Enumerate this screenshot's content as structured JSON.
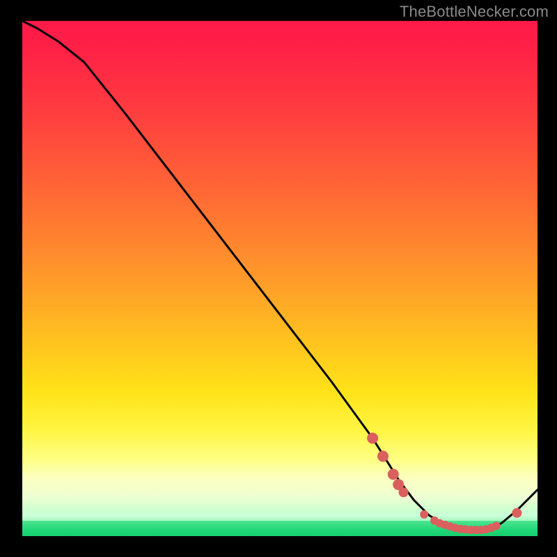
{
  "watermark": "TheBottleNecker.com",
  "colors": {
    "background": "#000000",
    "curve_stroke": "#000000",
    "marker_fill": "#d9605d",
    "gradient_top": "#ff1a49",
    "gradient_bottom": "#18cf70"
  },
  "chart_data": {
    "type": "line",
    "title": "",
    "xlabel": "",
    "ylabel": "",
    "xlim": [
      0,
      100
    ],
    "ylim": [
      0,
      100
    ],
    "x": [
      0,
      3,
      7,
      12,
      20,
      30,
      40,
      50,
      60,
      68,
      73,
      76,
      79,
      82,
      86,
      90,
      93,
      96,
      100
    ],
    "values": [
      100,
      98.5,
      96,
      92,
      82,
      69,
      56,
      43,
      30,
      19,
      11,
      7,
      4,
      2.2,
      1.2,
      1.2,
      2.5,
      5,
      9
    ],
    "markers": {
      "x": [
        68,
        70,
        72,
        73,
        74,
        78,
        80,
        81,
        82,
        83,
        84,
        85,
        86,
        87,
        88,
        89,
        90,
        91,
        92,
        96
      ],
      "y": [
        19,
        15.5,
        12,
        10,
        8.5,
        4.2,
        3.0,
        2.5,
        2.2,
        1.9,
        1.6,
        1.4,
        1.3,
        1.2,
        1.2,
        1.2,
        1.3,
        1.6,
        2.0,
        4.5
      ],
      "size": [
        8,
        8,
        8,
        8,
        7,
        6,
        6,
        6,
        6,
        6,
        6,
        6,
        6,
        6,
        6,
        6,
        6,
        6,
        6,
        7
      ]
    }
  }
}
